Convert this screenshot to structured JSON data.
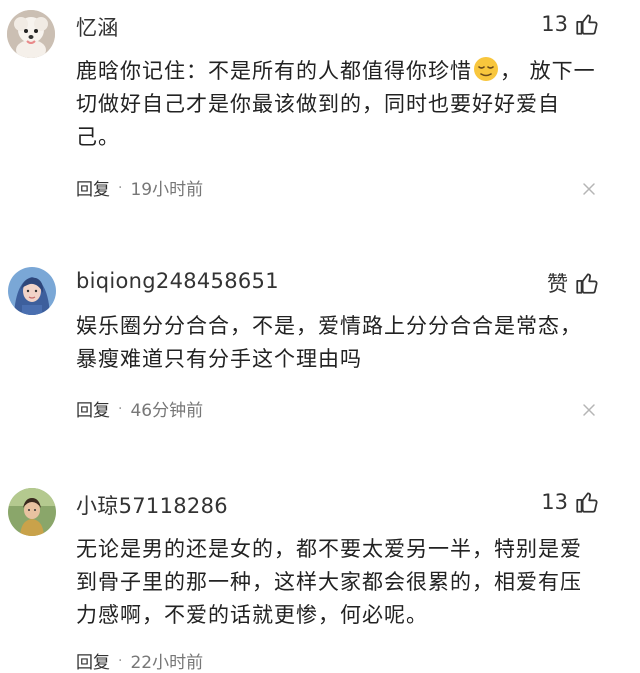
{
  "comments": [
    {
      "username": "忆涵",
      "likes": "13",
      "text_before_emoji": "鹿晗你记住：不是所有的人都值得你珍惜",
      "emoji": "relieved-face-emoji",
      "text_after_emoji": "， 放下一切做好自己才是你最该做到的，同时也要好好爱自己。",
      "reply_label": "回复",
      "time": "19小时前"
    },
    {
      "username": "biqiong248458651",
      "likes": "赞",
      "text": "娱乐圈分分合合，不是，爱情路上分分合合是常态，暴瘦难道只有分手这个理由吗",
      "reply_label": "回复",
      "time": "46分钟前"
    },
    {
      "username": "小琼57118286",
      "likes": "13",
      "text": "无论是男的还是女的，都不要太爱另一半，特别是爱到骨子里的那一种，这样大家都会很累的，相爱有压力感啊，不爱的话就更惨，何必呢。",
      "reply_label": "回复",
      "time": "22小时前"
    }
  ],
  "icons": {
    "like": "thumbs-up-icon",
    "close": "close-icon"
  },
  "colors": {
    "text": "#222222",
    "meta": "#777777",
    "icon": "#333333"
  }
}
